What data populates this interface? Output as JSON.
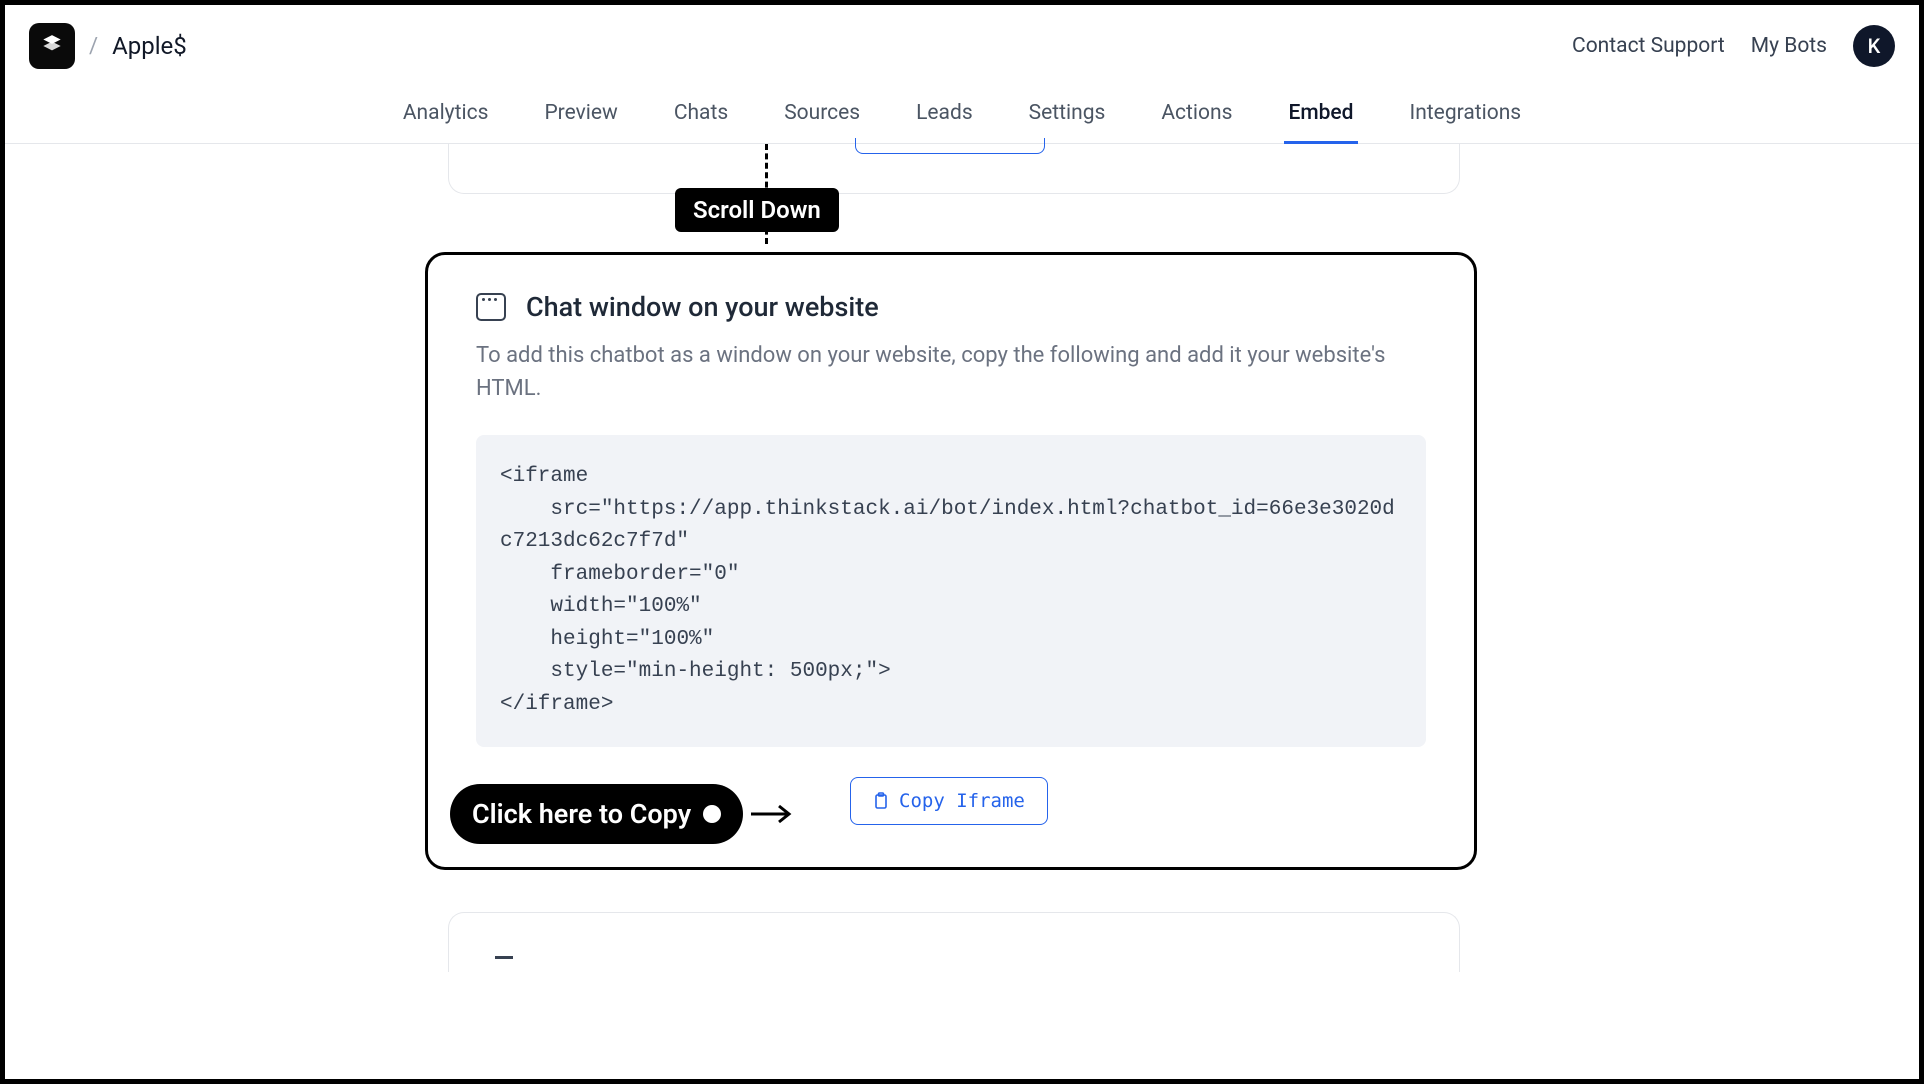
{
  "header": {
    "breadcrumb_sep": "/",
    "bot_name": "Apple$",
    "contact_support": "Contact Support",
    "my_bots": "My Bots",
    "avatar_initial": "K"
  },
  "tabs": {
    "analytics": "Analytics",
    "preview": "Preview",
    "chats": "Chats",
    "sources": "Sources",
    "leads": "Leads",
    "settings": "Settings",
    "actions": "Actions",
    "embed": "Embed",
    "integrations": "Integrations"
  },
  "annotations": {
    "scroll_down": "Scroll Down",
    "click_to_copy": "Click here to Copy"
  },
  "card": {
    "title": "Chat window on your website",
    "description": "To add this chatbot as a window on your website, copy the following and add it your website's HTML.",
    "code": "<iframe\n    src=\"https://app.thinkstack.ai/bot/index.html?chatbot_id=66e3e3020dc7213dc62c7f7d\"\n    frameborder=\"0\"\n    width=\"100%\"\n    height=\"100%\"\n    style=\"min-height: 500px;\">\n</iframe>",
    "copy_label": "Copy Iframe"
  }
}
